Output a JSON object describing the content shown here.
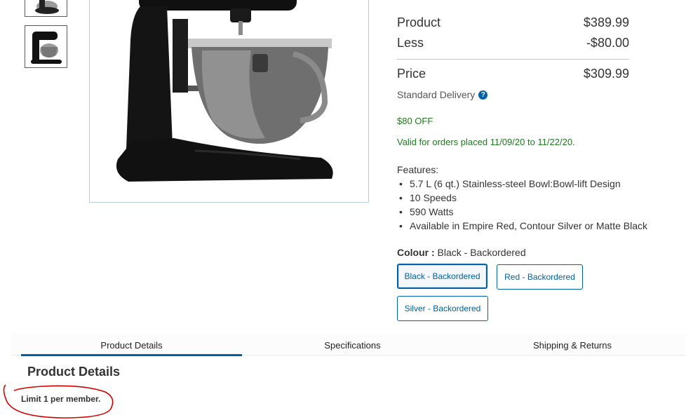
{
  "pricing": {
    "product_label": "Product",
    "product_value": "$389.99",
    "less_label": "Less",
    "less_value": "-$80.00",
    "price_label": "Price",
    "price_value": "$309.99",
    "delivery": "Standard Delivery",
    "help_glyph": "?"
  },
  "promo": {
    "off": "$80 OFF",
    "valid": "Valid for orders placed 11/09/20 to 11/22/20."
  },
  "features": {
    "label": "Features:",
    "items": [
      "5.7 L (6 qt.) Stainless-steel Bowl:Bowl-lift Design",
      "10 Speeds",
      "590 Watts",
      "Available in Empire Red, Contour Silver or Matte Black"
    ]
  },
  "colour": {
    "label": "Colour :",
    "selected": "Black - Backordered",
    "options": [
      "Black - Backordered",
      "Red - Backordered",
      "Silver - Backordered"
    ]
  },
  "tabs": [
    "Product Details",
    "Specifications",
    "Shipping & Returns"
  ],
  "details": {
    "title": "Product Details",
    "limit": "Limit 1 per member."
  },
  "colors": {
    "accent": "#0060a9",
    "promo": "#1e7a1e",
    "annotation": "#d40000"
  },
  "icons": {
    "help": "help-circle-icon"
  }
}
